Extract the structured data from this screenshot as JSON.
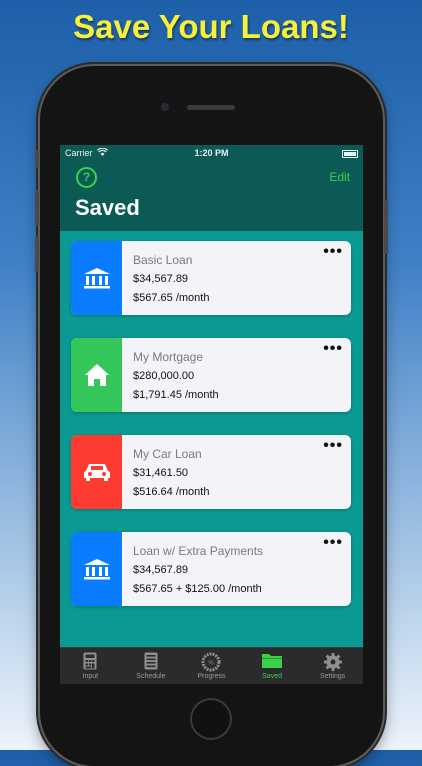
{
  "headline": "Save Your Loans!",
  "status_bar": {
    "carrier": "Carrier",
    "wifi_icon": "wifi-icon",
    "time": "1:20 PM",
    "battery_icon": "battery-icon"
  },
  "nav": {
    "help_icon": "?",
    "edit_label": "Edit",
    "title": "Saved"
  },
  "loans": [
    {
      "name": "Basic Loan",
      "amount": "$34,567.89",
      "payment": "$567.65 /month",
      "icon": "bank-icon",
      "color": "#0a7cff"
    },
    {
      "name": "My Mortgage",
      "amount": "$280,000.00",
      "payment": "$1,791.45 /month",
      "icon": "house-icon",
      "color": "#35c659"
    },
    {
      "name": "My Car Loan",
      "amount": "$31,461.50",
      "payment": "$516.64 /month",
      "icon": "car-icon",
      "color": "#fd3b30"
    },
    {
      "name": "Loan w/ Extra Payments",
      "amount": "$34,567.89",
      "payment": "$567.65 + $125.00 /month",
      "icon": "bank-icon",
      "color": "#0a7cff"
    }
  ],
  "tabs": [
    {
      "label": "Input",
      "icon": "calculator-icon",
      "active": false
    },
    {
      "label": "Schedule",
      "icon": "schedule-icon",
      "active": false
    },
    {
      "label": "Progress",
      "icon": "progress-icon",
      "active": false
    },
    {
      "label": "Saved",
      "icon": "folder-icon",
      "active": true
    },
    {
      "label": "Settings",
      "icon": "gear-icon",
      "active": false
    }
  ],
  "colors": {
    "background_top": "#1d5fa8",
    "headline": "#f6f03a",
    "navbar": "#0c5a55",
    "content": "#0a9a93",
    "accent": "#38d447",
    "tabbar": "#2b2b2b"
  }
}
